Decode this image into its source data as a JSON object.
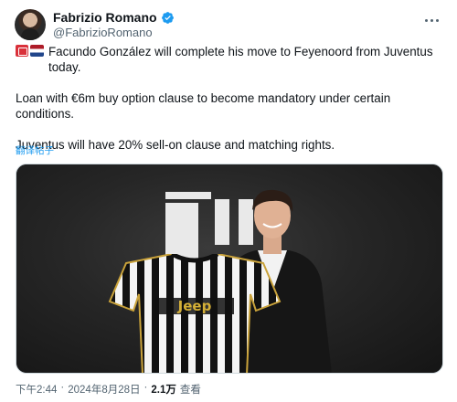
{
  "author": {
    "display_name": "Fabrizio Romano",
    "handle": "@FabrizioRomano"
  },
  "tweet": {
    "line1": "Facundo González will complete his move to Feyenoord from Juventus today.",
    "line2": "Loan with €6m buy option clause to become mandatory under certain conditions.",
    "line3": "Juventus will have 20% sell-on clause and matching rights.",
    "translate_link": "翻译帖子",
    "flags": [
      "italy-flag-icon",
      "netherlands-flag-icon"
    ]
  },
  "meta": {
    "time": "下午2:44",
    "separator": "·",
    "date": "2024年8月28日",
    "views_count": "2.1万",
    "views_label": "查看"
  },
  "icons": {
    "verified": "verified-badge-icon",
    "more": "more-options-icon"
  },
  "colors": {
    "link": "#1d9bf0",
    "secondary_text": "#536471",
    "verified": "#1d9bf0"
  }
}
